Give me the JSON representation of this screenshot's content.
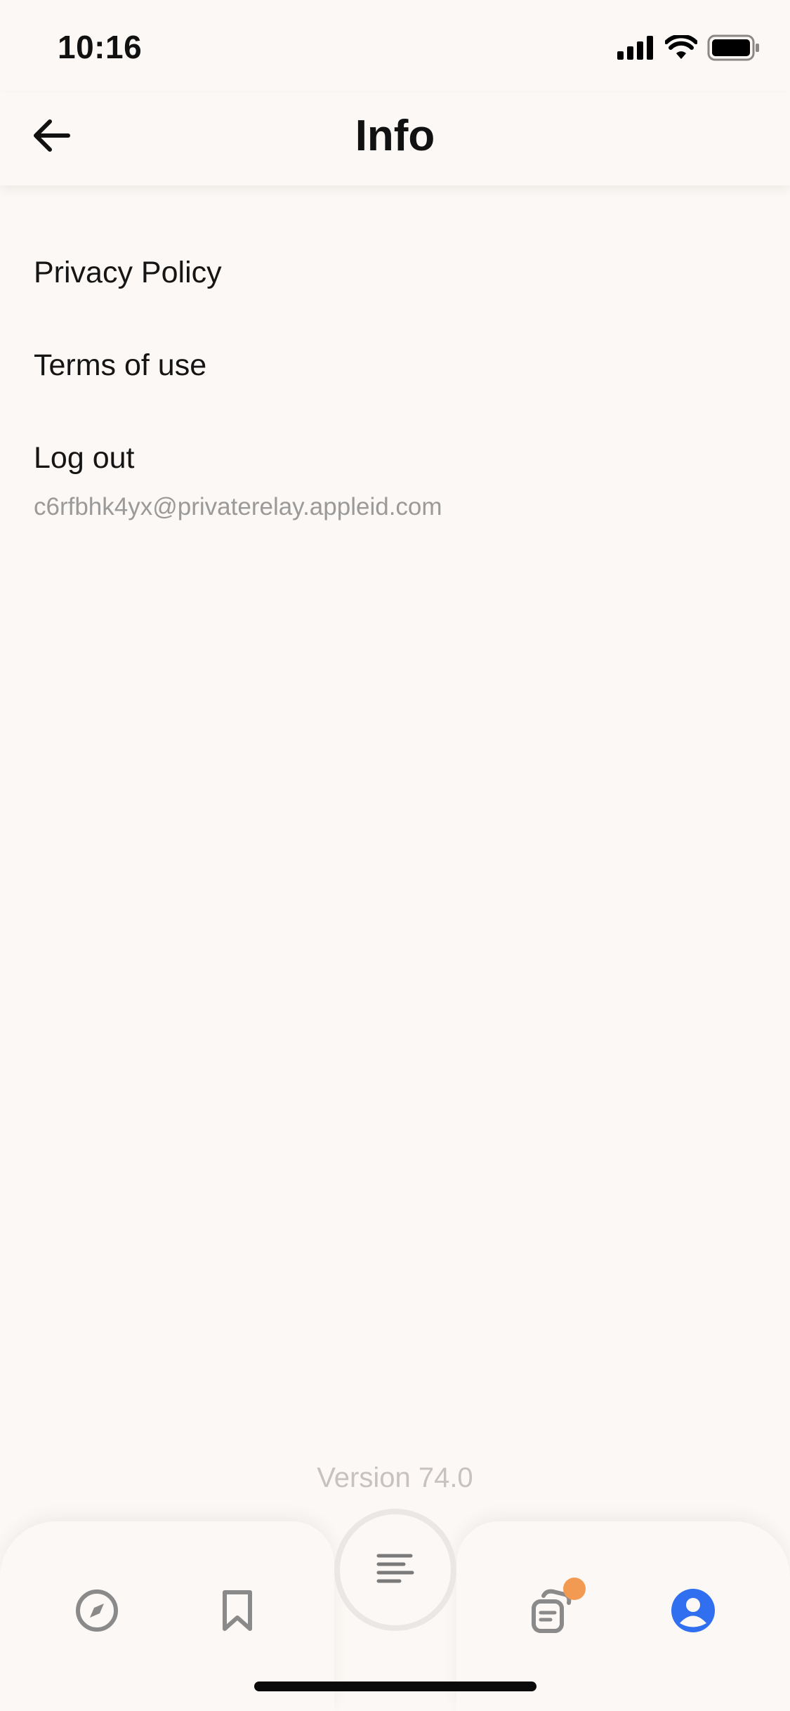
{
  "status_bar": {
    "time": "10:16",
    "icons": [
      "cellular-signal-icon",
      "wifi-icon",
      "battery-icon"
    ]
  },
  "header": {
    "title": "Info",
    "back_icon": "arrow-left-icon"
  },
  "menu": {
    "items": [
      {
        "label": "Privacy Policy"
      },
      {
        "label": "Terms of use"
      },
      {
        "label": "Log out",
        "sublabel": "c6rfbhk4yx@privaterelay.appleid.com"
      }
    ]
  },
  "footer": {
    "version": "Version 74.0"
  },
  "bottom_nav": {
    "items": [
      {
        "icon": "compass-icon",
        "active": false
      },
      {
        "icon": "bookmark-icon",
        "active": false
      },
      {
        "icon": "text-lines-icon",
        "active": false,
        "center": true
      },
      {
        "icon": "cards-icon",
        "active": false,
        "has_badge": true
      },
      {
        "icon": "profile-icon",
        "active": true
      }
    ]
  },
  "colors": {
    "background": "#fcf8f5",
    "active_accent": "#2f6ff0",
    "badge": "#f29a52",
    "inactive_icon": "#8a8a8a",
    "muted_text": "#9a9a9a",
    "version_text": "#c7c2bf"
  }
}
